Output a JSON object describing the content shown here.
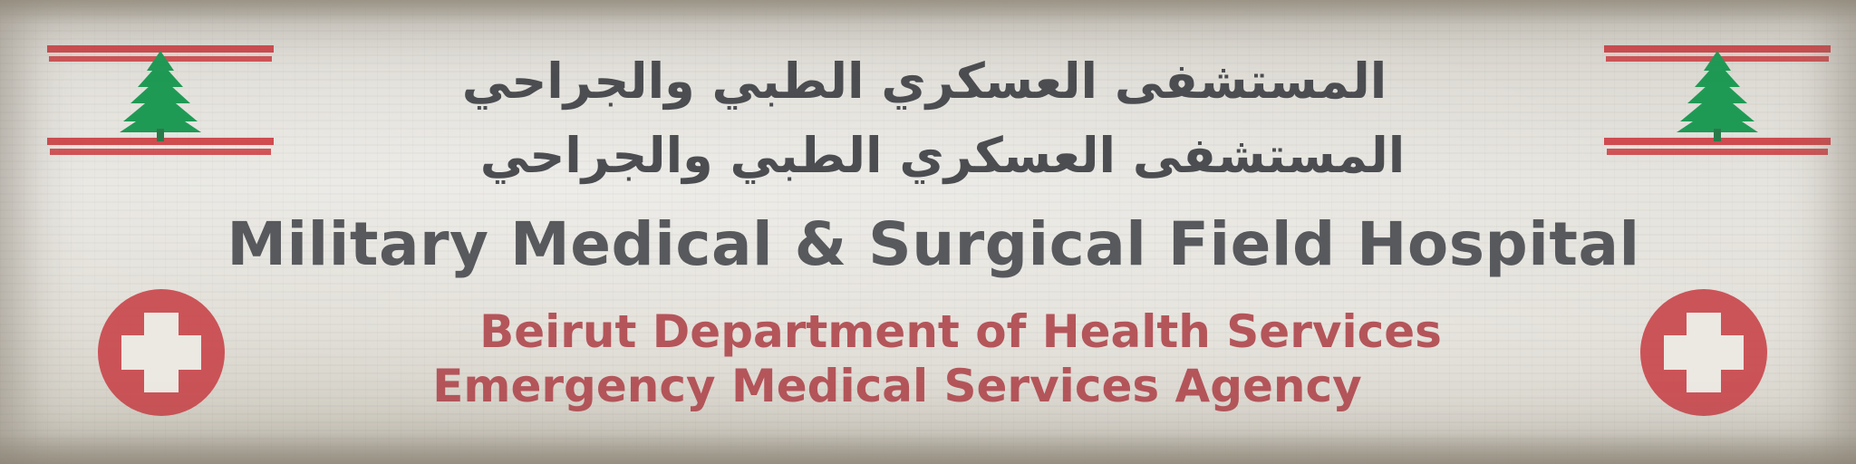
{
  "banner": {
    "arabic_line_1": "المستشفى العسكري الطبي والجراحي",
    "arabic_line_2": "المستشفى العسكري الطبي والجراحي",
    "title": "Military Medical & Surgical Field Hospital",
    "subtitle_line_1": "Beirut Department of Health Services",
    "subtitle_line_2": "Emergency Medical Services Agency"
  },
  "icons": {
    "flag": "lebanese-flag-icon",
    "cedar": "cedar-tree-icon",
    "cross": "medical-cross-icon"
  },
  "colors": {
    "background": "#dedbd3",
    "arabic_text": "#4b4d51",
    "title_text": "#57595d",
    "subtitle_text": "#b4555a",
    "flag_red": "#cc3b3f",
    "cedar_green": "#1f9a55",
    "emblem_red": "#c9484d"
  }
}
